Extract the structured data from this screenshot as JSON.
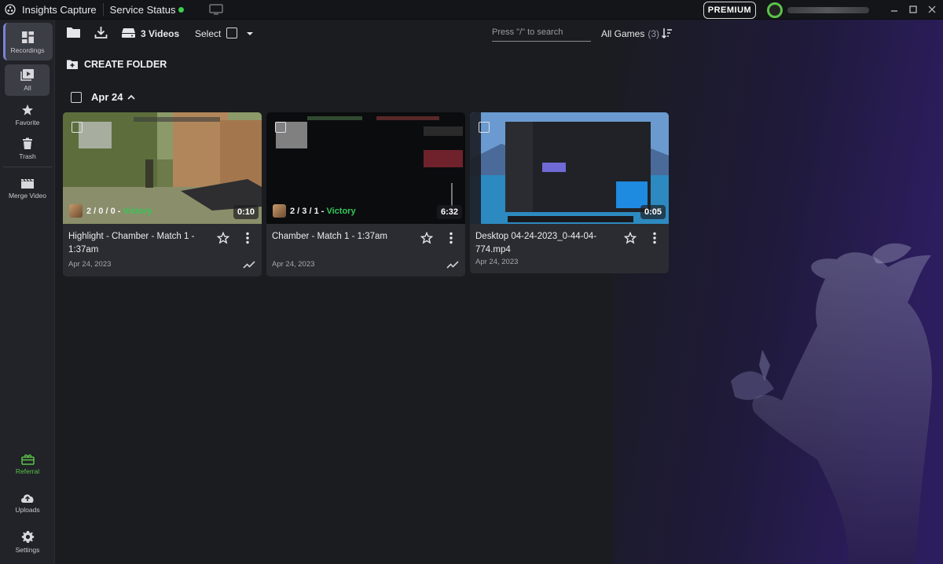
{
  "titlebar": {
    "app_title": "Insights Capture",
    "service_status": "Service Status",
    "premium": "PREMIUM",
    "status_color": "#3ccf4e"
  },
  "sidebar": {
    "recordings": "Recordings",
    "all": "All",
    "favorite": "Favorite",
    "trash": "Trash",
    "merge_video": "Merge Video",
    "referral": "Referral",
    "uploads": "Uploads",
    "settings": "Settings"
  },
  "toolbar": {
    "videos_count": "3 Videos",
    "select_label": "Select",
    "search_placeholder": "Press \"/\" to search",
    "games_filter": "All Games",
    "games_count": "(3)"
  },
  "create_folder": "CREATE FOLDER",
  "date_group": "Apr 24",
  "cards": [
    {
      "title": "Highlight - Chamber - Match 1 - 1:37am",
      "date": "Apr 24, 2023",
      "duration": "0:10",
      "kda": "2 / 0 / 0",
      "result": "Victory"
    },
    {
      "title": "Chamber - Match 1 - 1:37am",
      "date": "Apr 24, 2023",
      "duration": "6:32",
      "kda": "2 / 3 / 1",
      "result": "Victory"
    },
    {
      "title": "Desktop 04-24-2023_0-44-04-774.mp4",
      "date": "Apr 24, 2023",
      "duration": "0:05"
    }
  ],
  "colors": {
    "accent": "#7b83d6",
    "victory": "#34c759",
    "referral": "#5ac24a"
  }
}
